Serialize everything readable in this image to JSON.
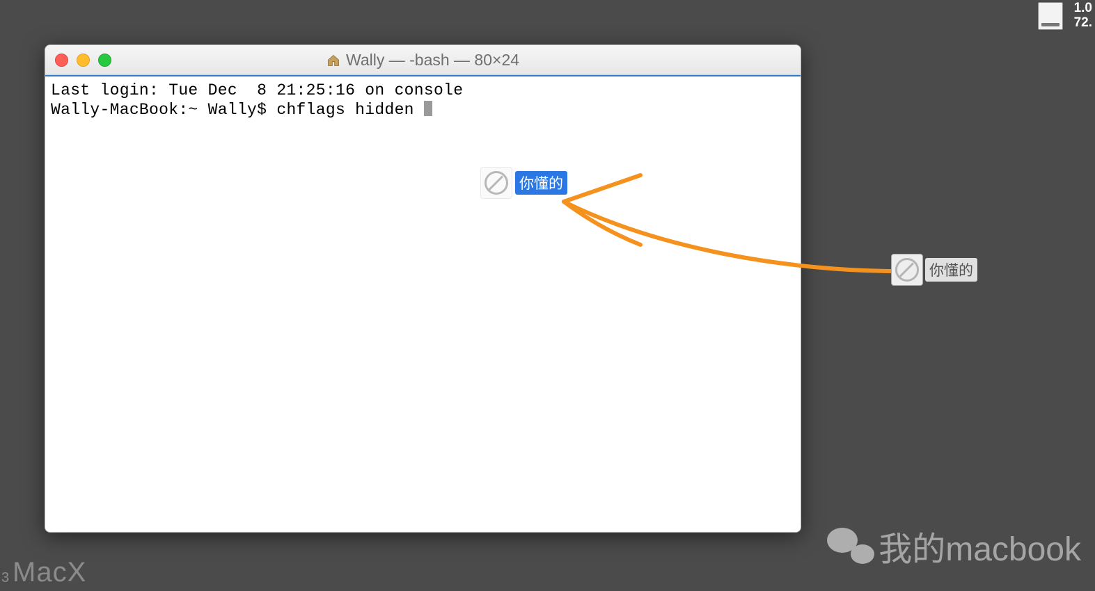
{
  "window": {
    "title": "Wally — -bash — 80×24"
  },
  "terminal": {
    "line1": "Last login: Tue Dec  8 21:25:16 on console",
    "prompt": "Wally-MacBook:~ Wally$ chflags hidden "
  },
  "dragged_file": {
    "label": "你懂的"
  },
  "desktop_file": {
    "label": "你懂的"
  },
  "menubar": {
    "line1": "1.0",
    "line2": "72."
  },
  "watermark": {
    "macx": "MacX",
    "macx_sub": "3",
    "wechat_text": "我的macbook"
  }
}
